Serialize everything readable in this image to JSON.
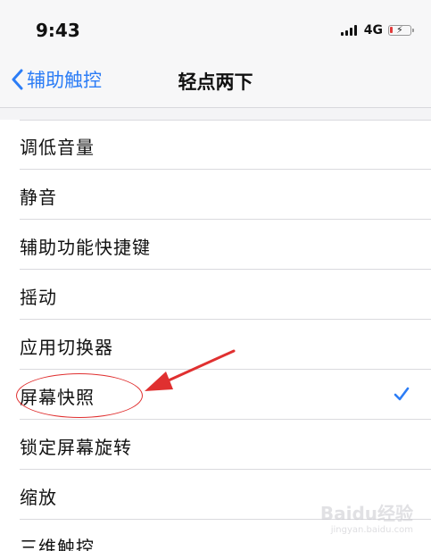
{
  "status_bar": {
    "time": "9:43",
    "network": "4G",
    "icons": [
      "signal-bars-icon",
      "battery-charging-icon"
    ]
  },
  "nav": {
    "back_label": "辅助触控",
    "title": "轻点两下",
    "back_icon": "chevron-left-icon"
  },
  "list": {
    "items": [
      {
        "label": "调低音量",
        "selected": false
      },
      {
        "label": "静音",
        "selected": false
      },
      {
        "label": "辅助功能快捷键",
        "selected": false
      },
      {
        "label": "摇动",
        "selected": false
      },
      {
        "label": "应用切换器",
        "selected": false
      },
      {
        "label": "屏幕快照",
        "selected": true
      },
      {
        "label": "锁定屏幕旋转",
        "selected": false
      },
      {
        "label": "缩放",
        "selected": false
      },
      {
        "label": "三维触控",
        "selected": false
      }
    ]
  },
  "watermark": {
    "brand": "Baidu经验",
    "url": "jingyan.baidu.com"
  },
  "colors": {
    "accent": "#2c7df6",
    "annotation": "#e03030"
  }
}
